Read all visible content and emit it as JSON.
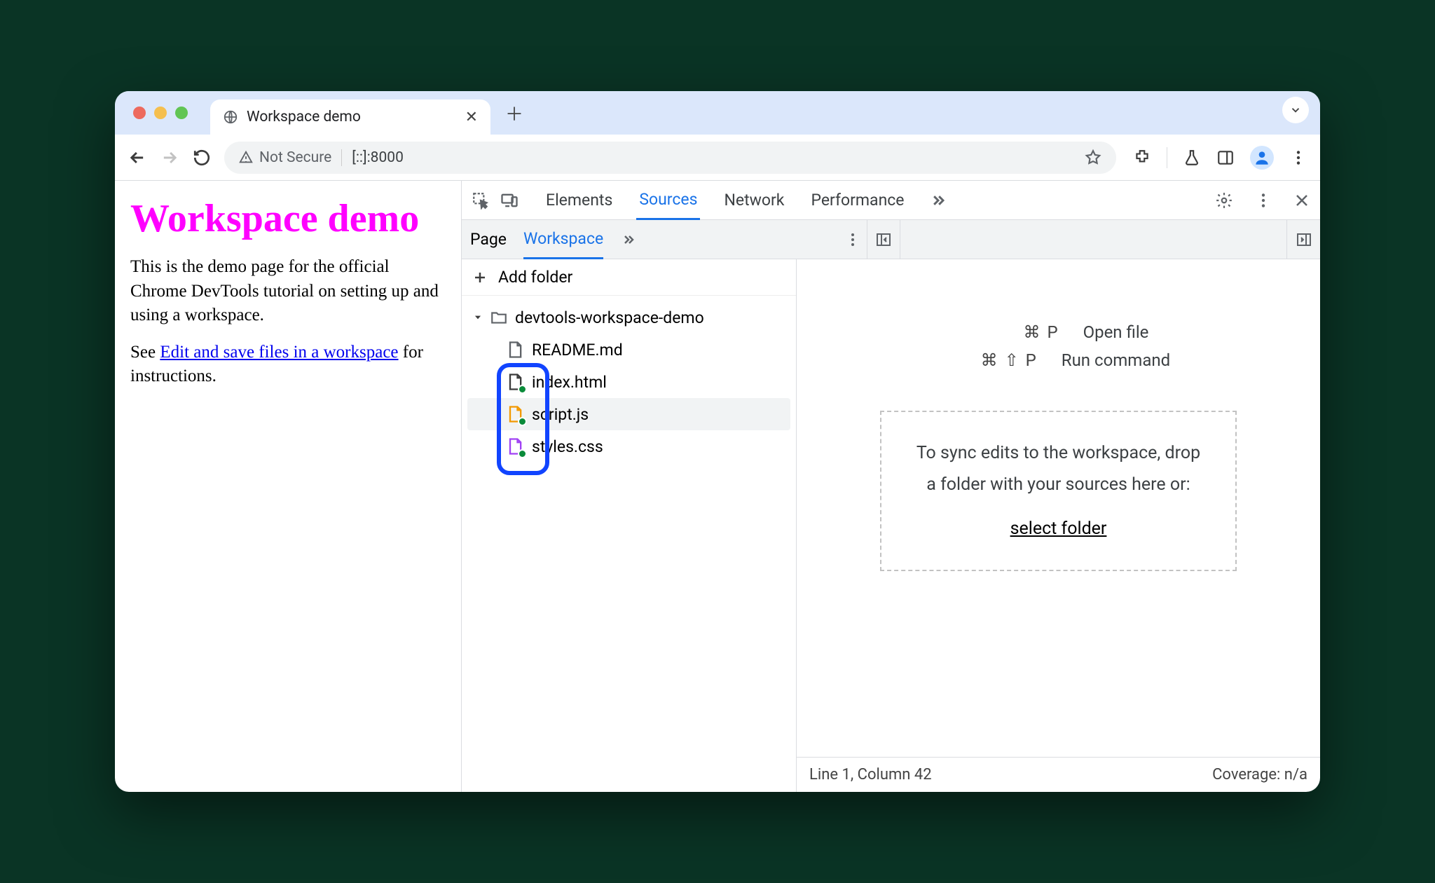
{
  "browser": {
    "tab_title": "Workspace demo",
    "not_secure": "Not Secure",
    "url": "[::]:8000"
  },
  "page": {
    "heading": "Workspace demo",
    "para1": "This is the demo page for the official Chrome DevTools tutorial on setting up and using a workspace.",
    "para2_prefix": "See ",
    "para2_link": "Edit and save files in a workspace",
    "para2_suffix": " for instructions."
  },
  "devtools": {
    "tabs": {
      "elements": "Elements",
      "sources": "Sources",
      "network": "Network",
      "performance": "Performance"
    },
    "subtabs": {
      "page": "Page",
      "workspace": "Workspace"
    },
    "add_folder": "Add folder",
    "folder": "devtools-workspace-demo",
    "files": {
      "readme": "README.md",
      "index": "index.html",
      "script": "script.js",
      "styles": "styles.css"
    },
    "shortcuts": {
      "open_keys": "⌘ P",
      "open_label": "Open file",
      "run_keys": "⌘ ⇧ P",
      "run_label": "Run command"
    },
    "drop_text1": "To sync edits to the workspace, drop",
    "drop_text2": "a folder with your sources here or:",
    "drop_link": "select folder",
    "status_left": "Line 1, Column 42",
    "status_right": "Coverage: n/a"
  }
}
